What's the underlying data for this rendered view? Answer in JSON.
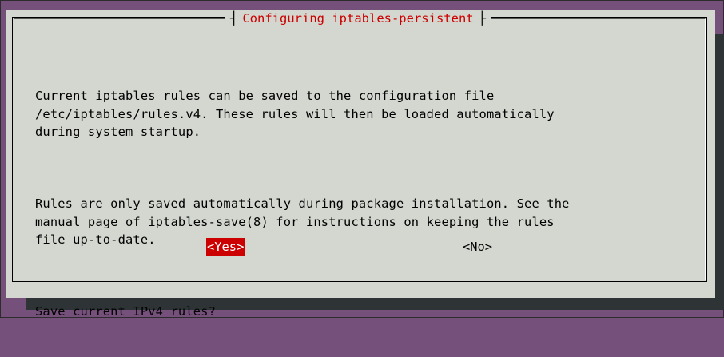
{
  "dialog": {
    "title": "Configuring iptables-persistent",
    "paragraphs": [
      "Current iptables rules can be saved to the configuration file\n/etc/iptables/rules.v4. These rules will then be loaded automatically\nduring system startup.",
      "Rules are only saved automatically during package installation. See the\nmanual page of iptables-save(8) for instructions on keeping the rules\nfile up-to-date.",
      "Save current IPv4 rules?"
    ],
    "buttons": {
      "yes": "<Yes>",
      "no": "<No>"
    },
    "selected_button": "yes"
  },
  "colors": {
    "desktop_background": "#75507b",
    "dialog_background": "#d3d7cf",
    "shadow": "#2e3436",
    "title_text": "#cc0000",
    "selected_button_background": "#cc0000",
    "selected_button_text": "#ffffff"
  }
}
